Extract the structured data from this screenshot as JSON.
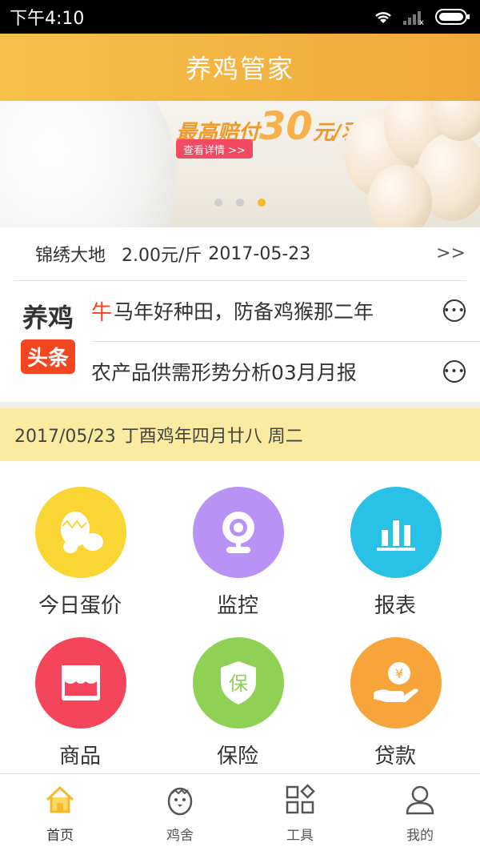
{
  "status_bar": {
    "time": "下午4:10"
  },
  "app_bar": {
    "title": "养鸡管家"
  },
  "banner": {
    "slogan_prefix": "最高赔付",
    "slogan_amount": "30",
    "slogan_suffix": "元/羽",
    "cta_label": "查看详情 >>",
    "page_count": 3,
    "active_page": 3,
    "accent_color": "#f5b92c"
  },
  "price_ticker": {
    "name": "锦绣大地",
    "price": "2.00元/斤",
    "date": "2017-05-23",
    "more_label": ">>"
  },
  "news": {
    "label_top": "养鸡",
    "label_bottom": "头条",
    "items": [
      {
        "tag": "牛",
        "title": "马年好种田，防备鸡猴那二年"
      },
      {
        "tag": "",
        "title": "农产品供需形势分析03月月报"
      }
    ],
    "more_icon": "more-horizontal-circle-icon"
  },
  "date_bar": {
    "text": "2017/05/23 丁酉鸡年四月廿八  周二"
  },
  "features": [
    {
      "label": "今日蛋价",
      "icon": "eggs-icon",
      "color": "#f9d633"
    },
    {
      "label": "监控",
      "icon": "webcam-icon",
      "color": "#b893f5"
    },
    {
      "label": "报表",
      "icon": "bar-chart-icon",
      "color": "#29c1e6"
    },
    {
      "label": "商品",
      "icon": "store-icon",
      "color": "#f5455d"
    },
    {
      "label": "保险",
      "icon": "shield-icon",
      "color": "#8fd155"
    },
    {
      "label": "贷款",
      "icon": "loan-hand-icon",
      "color": "#f7a43a"
    }
  ],
  "insurance_icon_text": "保",
  "loan_icon_text": "¥",
  "tabbar": {
    "items": [
      {
        "label": "首页",
        "icon": "home-icon",
        "active": true
      },
      {
        "label": "鸡舍",
        "icon": "chick-icon",
        "active": false
      },
      {
        "label": "工具",
        "icon": "tools-grid-icon",
        "active": false
      },
      {
        "label": "我的",
        "icon": "user-icon",
        "active": false
      }
    ],
    "active_color": "#f5b92c"
  }
}
